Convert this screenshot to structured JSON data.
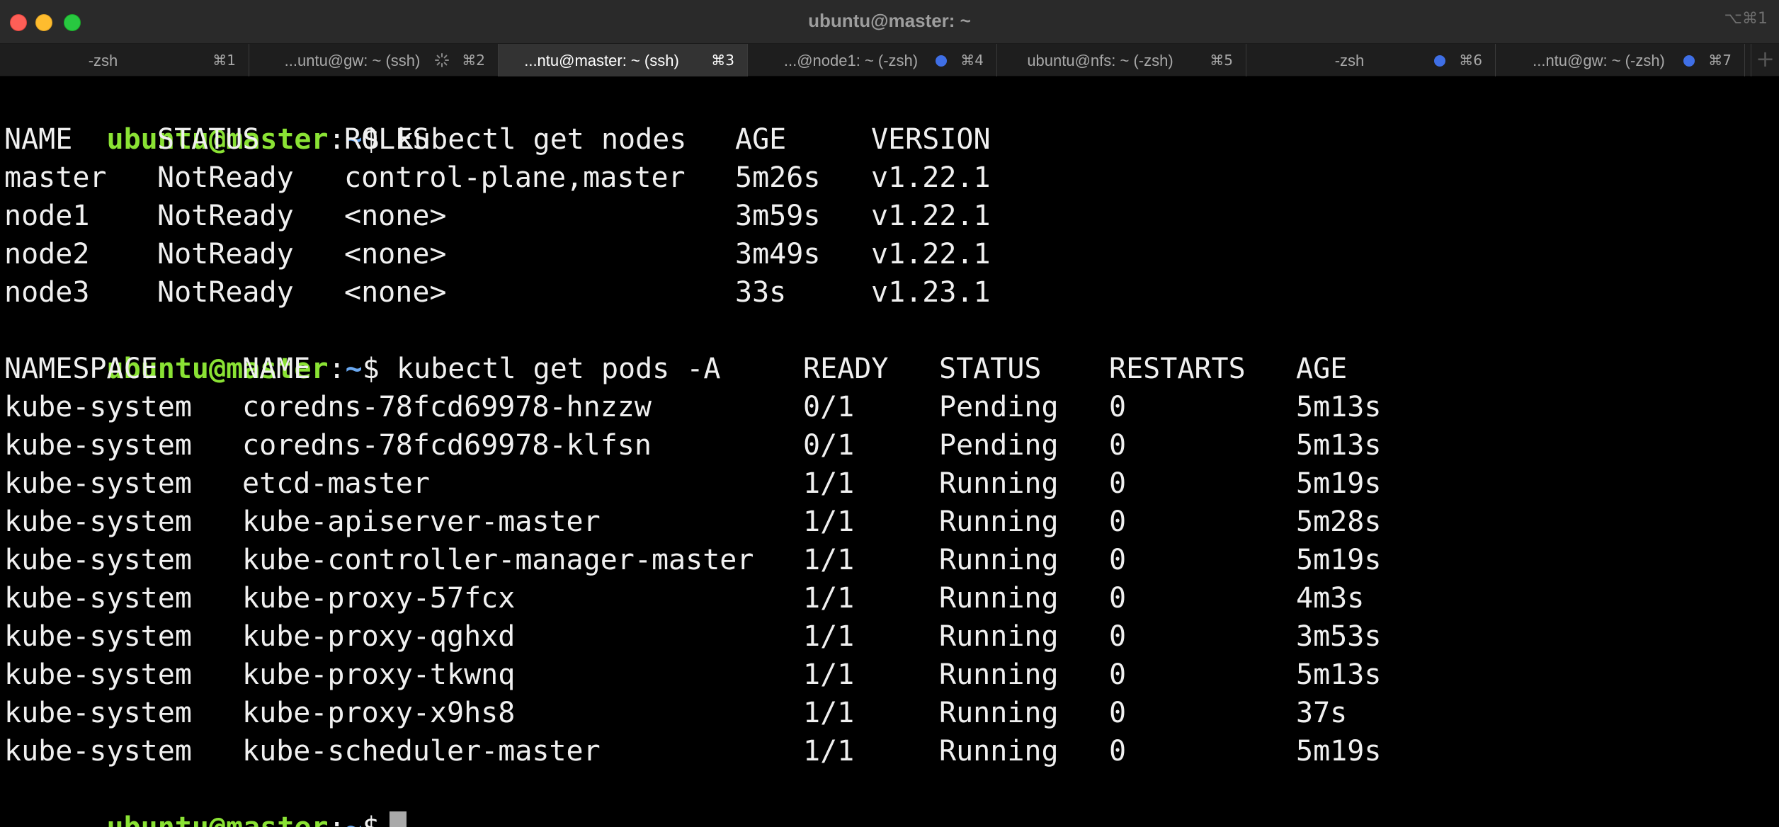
{
  "window": {
    "title": "ubuntu@master: ~",
    "shortcut": "⌥⌘1"
  },
  "tabs": [
    {
      "label": "-zsh",
      "key": "⌘1",
      "active": false,
      "indicator": "none"
    },
    {
      "label": "...untu@gw: ~ (ssh)",
      "key": "⌘2",
      "active": false,
      "indicator": "spinner"
    },
    {
      "label": "...ntu@master: ~ (ssh)",
      "key": "⌘3",
      "active": true,
      "indicator": "none"
    },
    {
      "label": "...@node1: ~ (-zsh)",
      "key": "⌘4",
      "active": false,
      "indicator": "dot"
    },
    {
      "label": "ubuntu@nfs: ~ (-zsh)",
      "key": "⌘5",
      "active": false,
      "indicator": "none"
    },
    {
      "label": "-zsh",
      "key": "⌘6",
      "active": false,
      "indicator": "dot"
    },
    {
      "label": "...ntu@gw: ~ (-zsh)",
      "key": "⌘7",
      "active": false,
      "indicator": "dot"
    }
  ],
  "add_tab_label": "+",
  "prompt": {
    "user_host": "ubuntu@master",
    "colon": ":",
    "path": "~",
    "symbol": "$"
  },
  "commands": {
    "get_nodes": "kubectl get nodes",
    "get_pods": "kubectl get pods -A"
  },
  "nodes": {
    "headers": [
      "NAME",
      "STATUS",
      "ROLES",
      "AGE",
      "VERSION"
    ],
    "rows": [
      [
        "master",
        "NotReady",
        "control-plane,master",
        "5m26s",
        "v1.22.1"
      ],
      [
        "node1",
        "NotReady",
        "<none>",
        "3m59s",
        "v1.22.1"
      ],
      [
        "node2",
        "NotReady",
        "<none>",
        "3m49s",
        "v1.22.1"
      ],
      [
        "node3",
        "NotReady",
        "<none>",
        "33s",
        "v1.23.1"
      ]
    ]
  },
  "pods": {
    "headers": [
      "NAMESPACE",
      "NAME",
      "READY",
      "STATUS",
      "RESTARTS",
      "AGE"
    ],
    "rows": [
      [
        "kube-system",
        "coredns-78fcd69978-hnzzw",
        "0/1",
        "Pending",
        "0",
        "5m13s"
      ],
      [
        "kube-system",
        "coredns-78fcd69978-klfsn",
        "0/1",
        "Pending",
        "0",
        "5m13s"
      ],
      [
        "kube-system",
        "etcd-master",
        "1/1",
        "Running",
        "0",
        "5m19s"
      ],
      [
        "kube-system",
        "kube-apiserver-master",
        "1/1",
        "Running",
        "0",
        "5m28s"
      ],
      [
        "kube-system",
        "kube-controller-manager-master",
        "1/1",
        "Running",
        "0",
        "5m19s"
      ],
      [
        "kube-system",
        "kube-proxy-57fcx",
        "1/1",
        "Running",
        "0",
        "4m3s"
      ],
      [
        "kube-system",
        "kube-proxy-qghxd",
        "1/1",
        "Running",
        "0",
        "3m53s"
      ],
      [
        "kube-system",
        "kube-proxy-tkwnq",
        "1/1",
        "Running",
        "0",
        "5m13s"
      ],
      [
        "kube-system",
        "kube-proxy-x9hs8",
        "1/1",
        "Running",
        "0",
        "37s"
      ],
      [
        "kube-system",
        "kube-scheduler-master",
        "1/1",
        "Running",
        "0",
        "5m19s"
      ]
    ]
  },
  "colors": {
    "prompt_user": "#8ae234",
    "prompt_path": "#6aa8f0",
    "background": "#000000",
    "tab_dot": "#3f6fe6"
  }
}
